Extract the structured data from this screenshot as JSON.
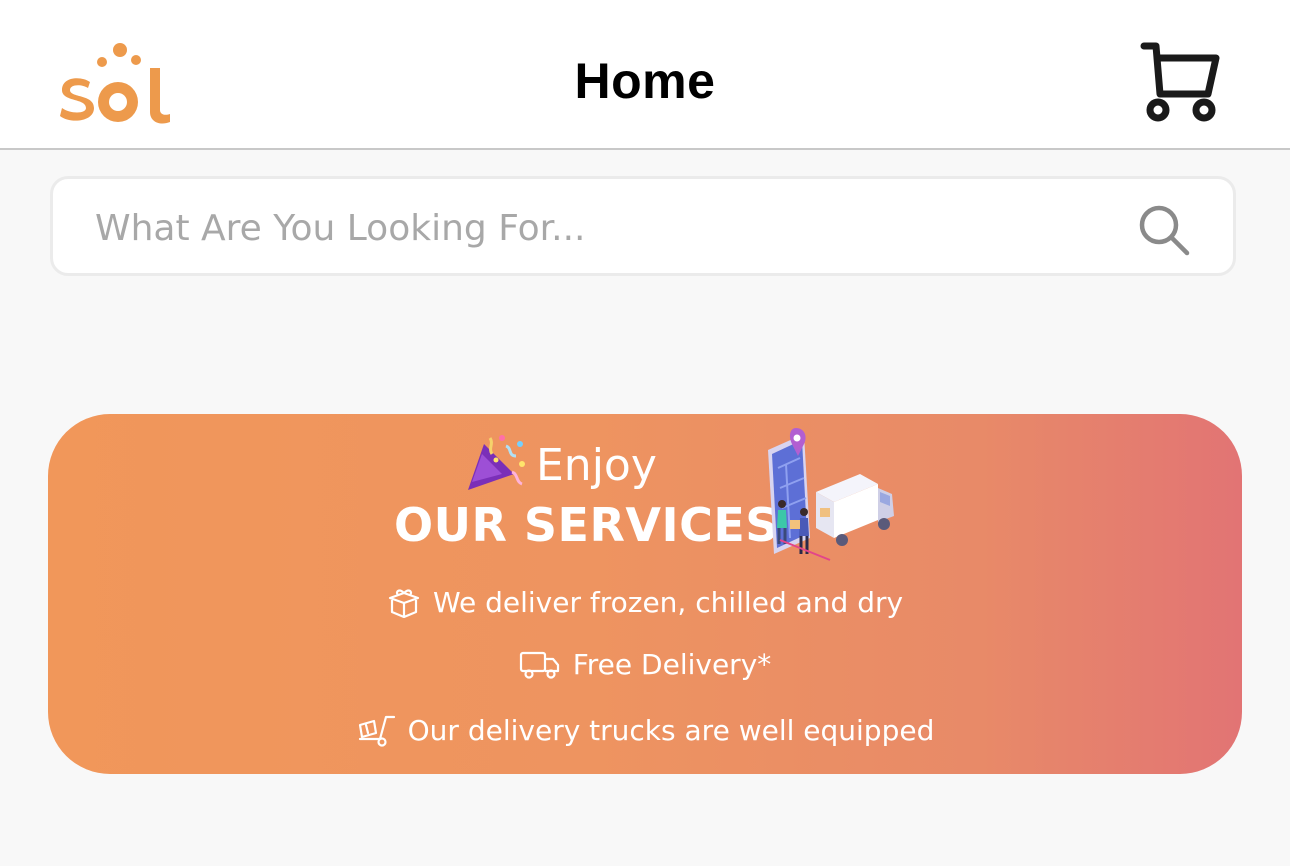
{
  "header": {
    "logo_text": "sol",
    "title": "Home",
    "cart_icon": "cart-icon",
    "brand_color": "#ed9a4c"
  },
  "search": {
    "placeholder": "What Are You Looking For...",
    "value": "",
    "icon": "search-icon"
  },
  "banner": {
    "enjoy": "Enjoy",
    "headline": "OUR SERVICES",
    "gradient_start": "#f1975a",
    "gradient_end": "#e27474",
    "features": [
      {
        "icon": "gift-icon",
        "text": "We deliver frozen, chilled and dry"
      },
      {
        "icon": "truck-icon",
        "text": "Free Delivery*"
      },
      {
        "icon": "hand-truck-icon",
        "text": "Our delivery trucks are well equipped"
      }
    ]
  }
}
